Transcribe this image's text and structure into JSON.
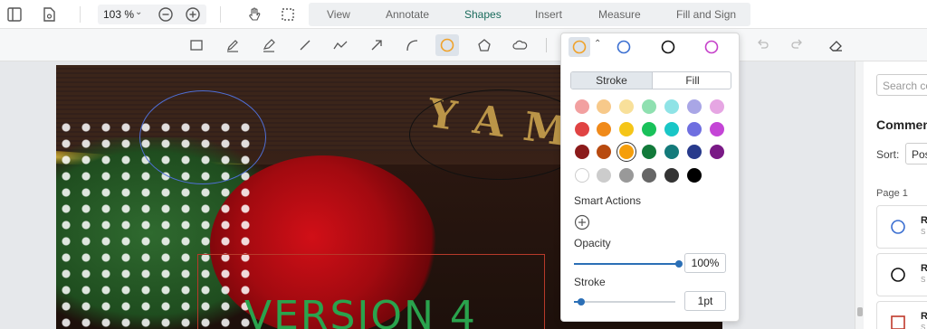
{
  "toolbar": {
    "zoom": "103",
    "zoom_unit": "%",
    "tabs": [
      {
        "label": "View"
      },
      {
        "label": "Annotate"
      },
      {
        "label": "Shapes"
      },
      {
        "label": "Insert"
      },
      {
        "label": "Measure"
      },
      {
        "label": "Fill and Sign"
      }
    ],
    "active_tab": "Shapes"
  },
  "document": {
    "brand_text": "YAM",
    "version_text": "VERSION 4"
  },
  "popup": {
    "presets": [
      {
        "color": "#f0a22a",
        "icon": "circle-outline-icon"
      },
      {
        "color": "#3b6fd1",
        "icon": "circle-outline-icon"
      },
      {
        "color": "#111111",
        "icon": "circle-outline-icon"
      },
      {
        "color": "#c53fc9",
        "icon": "circle-outline-icon"
      }
    ],
    "stroke_tab": "Stroke",
    "fill_tab": "Fill",
    "palette": [
      [
        "#f2a0a0",
        "#f7c98a",
        "#f8e09a",
        "#8fe0b0",
        "#8fe3e6",
        "#a9a6e6",
        "#e6a6e3"
      ],
      [
        "#e04343",
        "#f08a1a",
        "#f5c518",
        "#19c15a",
        "#19c6c6",
        "#6f6fe0",
        "#c445d6"
      ],
      [
        "#8b1a1a",
        "#b84a0f",
        "#f59e0b",
        "#127a3a",
        "#137a7a",
        "#283a8c",
        "#7a1a86"
      ],
      [
        "#ffffff",
        "#cccccc",
        "#999999",
        "#666666",
        "#333333",
        "#000000"
      ]
    ],
    "selected_color": "#f59e0b",
    "smart_actions_label": "Smart Actions",
    "opacity_label": "Opacity",
    "opacity_value": "100%",
    "opacity_level": 1.0,
    "stroke_label": "Stroke",
    "stroke_value": "1pt",
    "stroke_level": 0.07
  },
  "panel": {
    "search_placeholder": "Search co",
    "title": "Commen",
    "sort_label": "Sort:",
    "sort_value": "Pos",
    "page_label": "Page 1",
    "cards": [
      {
        "icon": "blue-circle-icon",
        "name": "R",
        "sub": "S"
      },
      {
        "icon": "black-circle-icon",
        "name": "R",
        "sub": "S"
      },
      {
        "icon": "red-square-icon",
        "name": "R",
        "sub": "S"
      }
    ]
  }
}
